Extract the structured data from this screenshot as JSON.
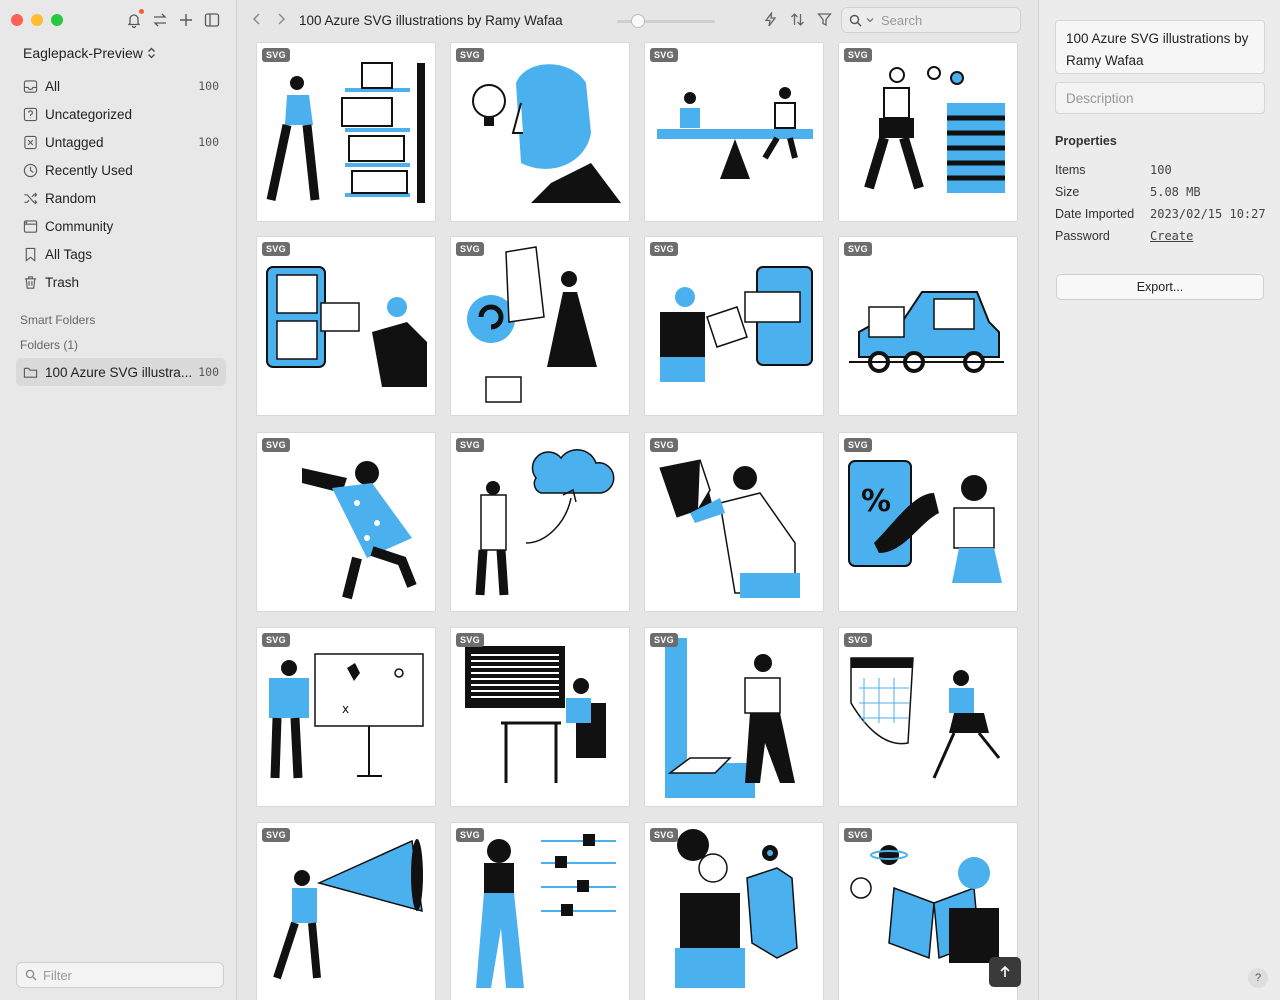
{
  "sidebar": {
    "library_name": "Eaglepack-Preview",
    "items": [
      {
        "label": "All",
        "count": "100",
        "icon": "inbox-icon"
      },
      {
        "label": "Uncategorized",
        "count": "",
        "icon": "question-icon"
      },
      {
        "label": "Untagged",
        "count": "100",
        "icon": "untagged-icon"
      },
      {
        "label": "Recently Used",
        "count": "",
        "icon": "clock-icon"
      },
      {
        "label": "Random",
        "count": "",
        "icon": "shuffle-icon"
      },
      {
        "label": "Community",
        "count": "",
        "icon": "community-icon"
      },
      {
        "label": "All Tags",
        "count": "",
        "icon": "bookmark-icon"
      },
      {
        "label": "Trash",
        "count": "",
        "icon": "trash-icon"
      }
    ],
    "smart_folders_label": "Smart Folders",
    "folders_label": "Folders (1)",
    "folder": {
      "label": "100 Azure SVG illustra...",
      "count": "100"
    },
    "filter_placeholder": "Filter"
  },
  "toolbar": {
    "title": "100 Azure SVG illustrations by Ramy Wafaa",
    "search_placeholder": "Search"
  },
  "grid": {
    "badge": "SVG",
    "accent": "#4ab0ee",
    "count_visible": 20
  },
  "inspector": {
    "name": "100 Azure SVG illustrations by Ramy Wafaa",
    "description_placeholder": "Description",
    "properties_label": "Properties",
    "properties": [
      {
        "key": "Items",
        "value": "100"
      },
      {
        "key": "Size",
        "value": "5.08 MB"
      },
      {
        "key": "Date Imported",
        "value": "2023/02/15 10:27"
      },
      {
        "key": "Password",
        "value": "Create"
      }
    ],
    "export_label": "Export...",
    "help_label": "?"
  }
}
